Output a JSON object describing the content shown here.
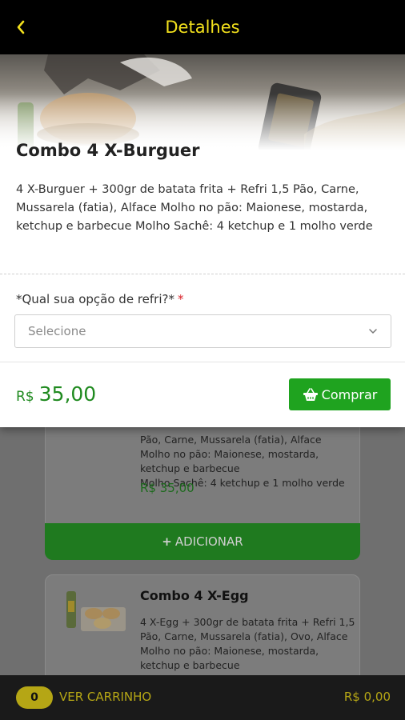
{
  "header": {
    "title": "Detalhes",
    "back_icon": "chevron-left-icon"
  },
  "product": {
    "name": "Combo 4 X-Burguer",
    "description": "4 X-Burguer + 300gr de batata frita + Refri 1,5 Pão, Carne, Mussarela (fatia), Alface Molho no pão: Maionese, mostarda, ketchup e barbecue Molho Sachê: 4 ketchup e 1 molho verde"
  },
  "option": {
    "label": "*Qual sua opção de refri?*",
    "required_mark": "*",
    "placeholder": "Selecione"
  },
  "purchase": {
    "currency": "R$",
    "price": "35,00",
    "buy_label": "Comprar",
    "buy_icon": "shopping-basket-icon"
  },
  "background_list": {
    "item1": {
      "desc_lines": [
        "Pão, Carne, Mussarela (fatia), Alface",
        "Molho no pão: Maionese, mostarda,",
        "ketchup e barbecue",
        "Molho Sachê: 4 ketchup e 1 molho verde"
      ],
      "price": "R$ 35,00",
      "add_label": "ADICIONAR"
    },
    "item2": {
      "name": "Combo 4 X-Egg",
      "desc_lines": [
        "4 X-Egg + 300gr de batata frita + Refri 1,5",
        "Pão, Carne, Mussarela (fatia), Ovo, Alface",
        "Molho no pão: Maionese, mostarda,",
        "ketchup e barbecue"
      ]
    }
  },
  "cart": {
    "count": "0",
    "label": "VER CARRINHO",
    "total": "R$ 0,00"
  },
  "colors": {
    "accent_yellow": "#f2e01c",
    "green": "#1fa31f",
    "price_green": "#1f8a1f",
    "required_red": "#d9232b"
  }
}
